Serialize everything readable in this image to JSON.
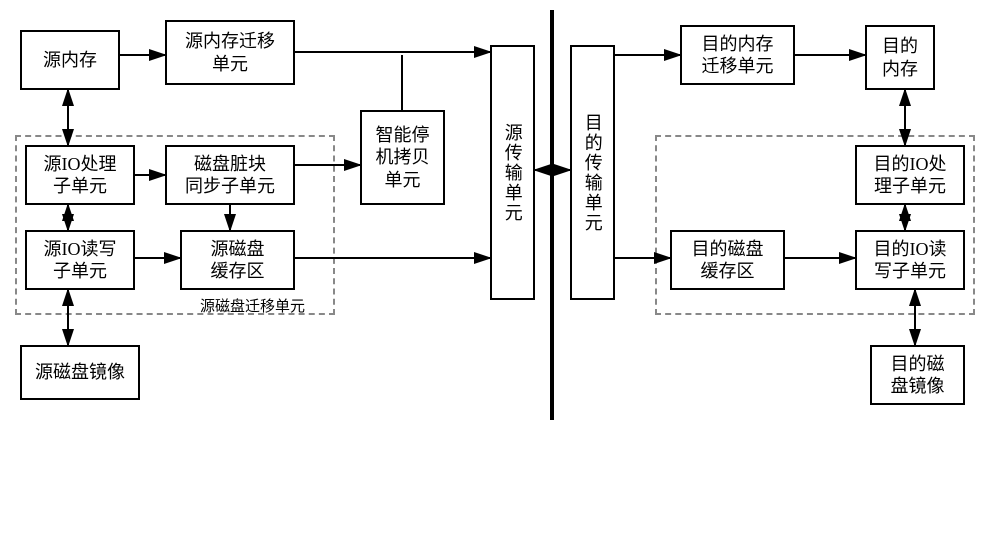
{
  "left": {
    "src_mem": "源内存",
    "src_mem_mig": "源内存迁移\n单元",
    "src_io_proc": "源IO处理\n子单元",
    "dirty_sync": "磁盘脏块\n同步子单元",
    "src_io_rw": "源IO读写\n子单元",
    "src_disk_cache": "源磁盘\n缓存区",
    "src_disk_mirror": "源磁盘镜像",
    "smart_stop_copy": "智能停\n机拷贝\n单元",
    "src_disk_mig_label": "源磁盘迁移单元",
    "src_trans": "源传输单元"
  },
  "right": {
    "dst_trans": "目的传输单元",
    "dst_mem_mig": "目的内存\n迁移单元",
    "dst_mem": "目的\n内存",
    "dst_io_proc": "目的IO处\n理子单元",
    "dst_io_rw": "目的IO读\n写子单元",
    "dst_disk_cache": "目的磁盘\n缓存区",
    "dst_disk_mirror": "目的磁\n盘镜像"
  }
}
